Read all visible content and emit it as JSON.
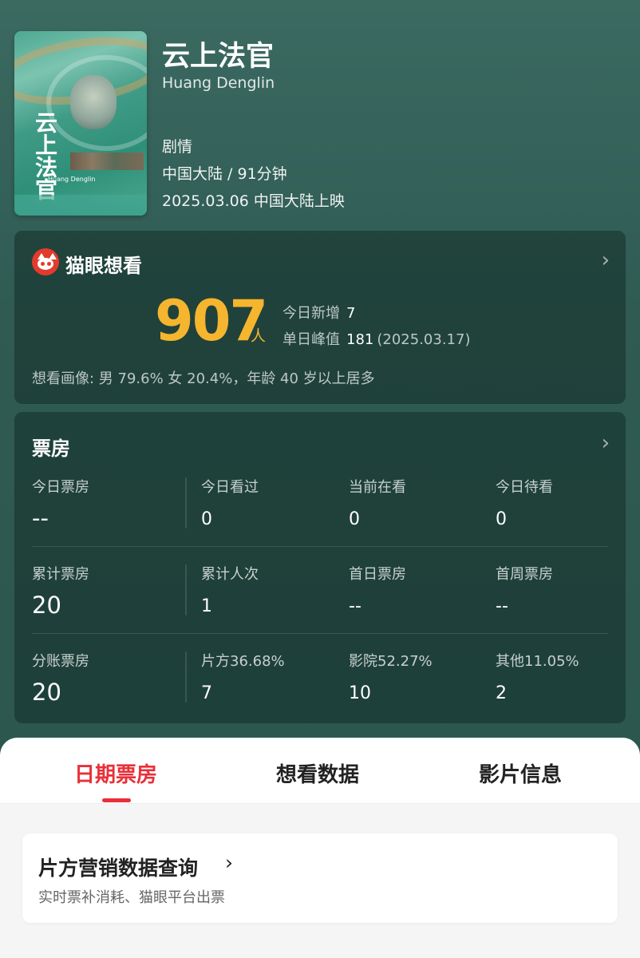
{
  "movie": {
    "title": "云上法官",
    "english_title": "Huang Denglin",
    "genre": "剧情",
    "region_duration": "中国大陆 / 91分钟",
    "release": "2025.03.06 中国大陆上映",
    "poster": {
      "title": "云上法官",
      "subtitle": "Huang Denglin"
    }
  },
  "want": {
    "brand": "猫眼想看",
    "count": "907",
    "unit": "人",
    "today_new_label": "今日新增",
    "today_new_value": "7",
    "peak_label": "单日峰值",
    "peak_value": "181",
    "peak_date": "(2025.03.17)",
    "portrait": "想看画像: 男 79.6%  女 20.4%，年龄 40 岁以上居多"
  },
  "boxoffice": {
    "title": "票房",
    "rows": [
      [
        {
          "label": "今日票房",
          "value": "--"
        },
        {
          "label": "今日看过",
          "value": "0"
        },
        {
          "label": "当前在看",
          "value": "0"
        },
        {
          "label": "今日待看",
          "value": "0"
        }
      ],
      [
        {
          "label": "累计票房",
          "value": "20"
        },
        {
          "label": "累计人次",
          "value": "1"
        },
        {
          "label": "首日票房",
          "value": "--"
        },
        {
          "label": "首周票房",
          "value": "--"
        }
      ],
      [
        {
          "label": "分账票房",
          "value": "20"
        },
        {
          "label": "片方36.68%",
          "value": "7"
        },
        {
          "label": "影院52.27%",
          "value": "10"
        },
        {
          "label": "其他11.05%",
          "value": "2"
        }
      ]
    ]
  },
  "tabs": [
    {
      "label": "日期票房",
      "active": true
    },
    {
      "label": "想看数据",
      "active": false
    },
    {
      "label": "影片信息",
      "active": false
    }
  ],
  "promo": {
    "title": "片方营销数据查询",
    "chevron": "›",
    "subtitle": "实时票补消耗、猫眼平台出票"
  },
  "icons": {
    "chevron": "›",
    "brand_logo": "maoyan-cat-icon"
  },
  "colors": {
    "accent_red": "#e8303a",
    "want_number": "#f5b52e",
    "background": "#2f5b53"
  }
}
